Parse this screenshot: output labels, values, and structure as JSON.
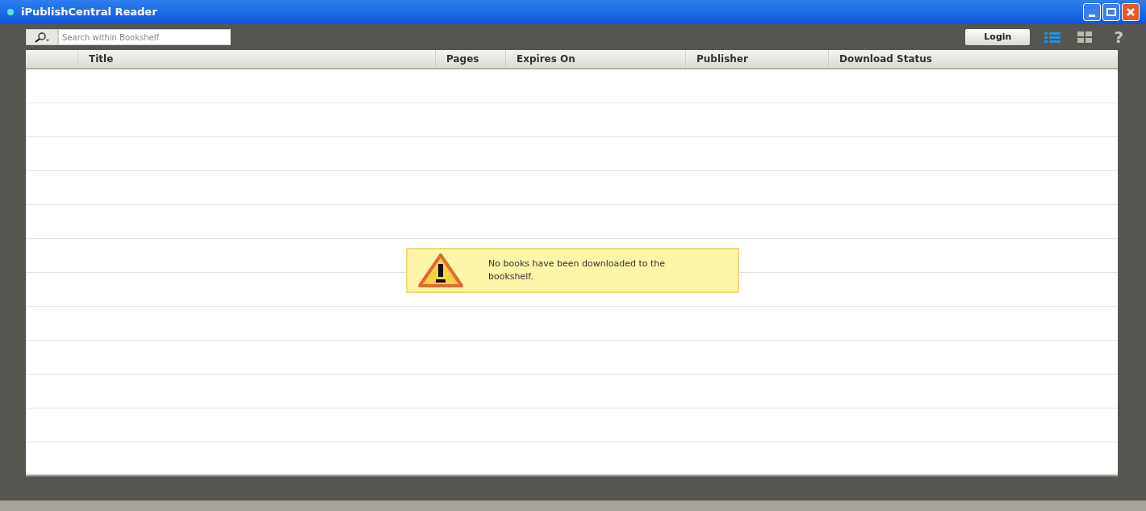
{
  "window": {
    "title": "iPublishCentral Reader"
  },
  "toolbar": {
    "search": {
      "placeholder": "Search within Bookshelf"
    },
    "login_button": "Login",
    "views": [
      {
        "kind": "list",
        "selected": true
      },
      {
        "kind": "grid",
        "selected": false
      }
    ],
    "help": "?"
  },
  "table": {
    "columns": [
      "Title",
      "Pages",
      "Expires On",
      "Publisher",
      "Download Status"
    ]
  },
  "message": {
    "text": "No books have been downloaded to the bookshelf."
  }
}
